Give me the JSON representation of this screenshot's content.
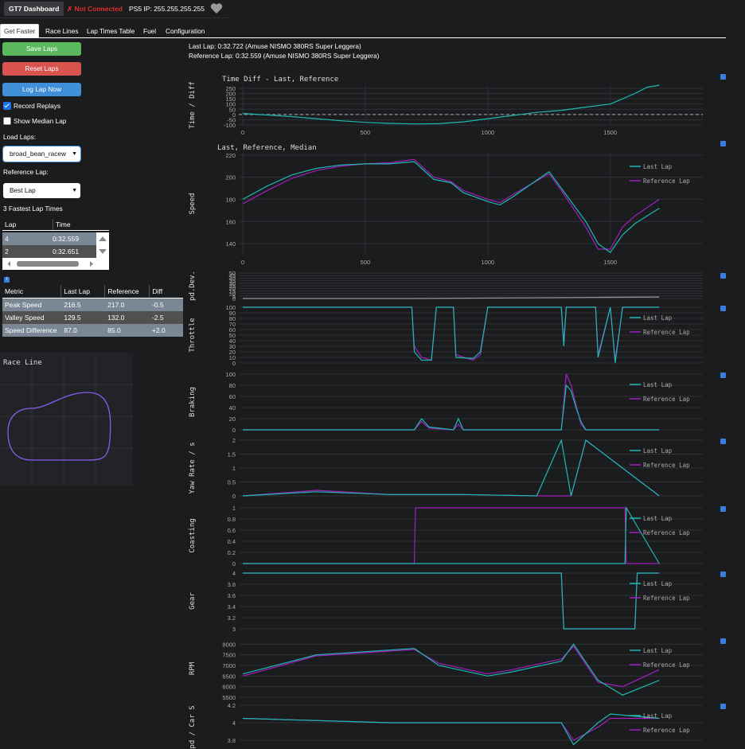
{
  "header": {
    "brand": "GT7 Dashboard",
    "connection_status": "✗ Not Connected",
    "ps5_ip": "PS5 IP: 255.255.255.255",
    "heart_icon": "heart-icon"
  },
  "tabs": [
    "Get Faster",
    "Race Lines",
    "Lap Times Table",
    "Fuel",
    "Configuration"
  ],
  "sidebar": {
    "save_laps": "Save Laps",
    "reset_laps": "Reset Laps",
    "log_lap_now": "Log Lap Now",
    "record_replays": "Record Replays",
    "show_median_lap": "Show Median Lap",
    "load_laps_label": "Load Laps:",
    "load_laps_value": "broad_bean_racew",
    "reference_lap_label": "Reference Lap:",
    "reference_lap_value": "Best Lap",
    "fastest_title": "3 Fastest Lap Times",
    "fastest_headers": [
      "Lap",
      "Time"
    ],
    "fastest_rows": [
      [
        "4",
        "0:32.559"
      ],
      [
        "2",
        "0:32.651"
      ]
    ],
    "metric_headers": [
      "Metric",
      "Last Lap",
      "Reference",
      "Diff"
    ],
    "metric_rows": [
      [
        "Peak Speed",
        "216.5",
        "217.0",
        "-0.5"
      ],
      [
        "Valley Speed",
        "129.5",
        "132.0",
        "-2.5"
      ],
      [
        "Speed Difference",
        "87.0",
        "85.0",
        "+2.0"
      ]
    ],
    "race_line_title": "Race Line"
  },
  "lap_info": {
    "last_lap": "Last Lap: 0:32.722 (Amuse NISMO 380RS Super Leggera)",
    "reference_lap": "Reference Lap: 0:32.559 (Amuse NISMO 380RS Super Leggera)"
  },
  "colors": {
    "last": "#1fb8b0",
    "reference": "#a020c0",
    "median": "#9a9a9a",
    "grid": "#2e3036"
  },
  "chart_data": [
    {
      "type": "line",
      "title": "Time Diff - Last, Reference",
      "ylabel": "Time / Diff",
      "x": [
        0,
        100,
        200,
        300,
        400,
        500,
        600,
        700,
        800,
        900,
        1000,
        1100,
        1200,
        1300,
        1400,
        1500,
        1600,
        1650,
        1700
      ],
      "series": [
        {
          "values": [
            10,
            -5,
            -20,
            -40,
            -60,
            -75,
            -85,
            -90,
            -88,
            -70,
            -40,
            -10,
            20,
            40,
            70,
            100,
            200,
            260,
            280
          ]
        }
      ],
      "ylim": [
        -100,
        280
      ],
      "yticks": [
        -100,
        -50,
        0,
        50,
        100,
        150,
        200,
        250
      ],
      "xticks": [
        0,
        500,
        1000,
        1500
      ],
      "dashed_y": 0
    },
    {
      "type": "line",
      "title": "Last, Reference, Median",
      "ylabel": "Speed",
      "x": [
        0,
        100,
        200,
        300,
        400,
        500,
        600,
        700,
        730,
        780,
        850,
        900,
        1000,
        1050,
        1100,
        1250,
        1300,
        1400,
        1450,
        1500,
        1550,
        1600,
        1700
      ],
      "series": [
        {
          "name": "Last Lap",
          "values": [
            180,
            192,
            202,
            208,
            211,
            212,
            212,
            214,
            208,
            198,
            195,
            186,
            178,
            175,
            182,
            205,
            190,
            160,
            140,
            132,
            148,
            158,
            172
          ]
        },
        {
          "name": "Reference Lap",
          "values": [
            176,
            188,
            199,
            206,
            210,
            212,
            213,
            216,
            210,
            200,
            196,
            188,
            180,
            177,
            184,
            203,
            188,
            155,
            135,
            135,
            155,
            165,
            180
          ]
        }
      ],
      "ylim": [
        130,
        222
      ],
      "yticks": [
        140,
        160,
        180,
        200,
        220
      ],
      "xticks": [
        0,
        500,
        1000,
        1500
      ]
    },
    {
      "type": "line",
      "ylabel": "pd.Dev.",
      "x": [
        0,
        700,
        1400,
        1700
      ],
      "series": [
        {
          "values": [
            0,
            0,
            2,
            3
          ]
        }
      ],
      "ylim": [
        0,
        50
      ],
      "yticks": [
        0,
        5,
        10,
        15,
        20,
        25,
        30,
        35,
        40,
        45,
        50
      ]
    },
    {
      "type": "line",
      "ylabel": "Throttle",
      "x": [
        0,
        690,
        700,
        730,
        770,
        790,
        860,
        870,
        940,
        970,
        1000,
        1020,
        1300,
        1310,
        1320,
        1360,
        1440,
        1450,
        1500,
        1520,
        1550,
        1700
      ],
      "series": [
        {
          "name": "Last Lap",
          "values": [
            100,
            100,
            20,
            5,
            5,
            100,
            100,
            10,
            8,
            20,
            100,
            100,
            100,
            30,
            100,
            100,
            100,
            10,
            100,
            0,
            100,
            100
          ]
        },
        {
          "name": "Reference Lap",
          "values": [
            100,
            100,
            30,
            10,
            5,
            100,
            100,
            15,
            5,
            15,
            100,
            100,
            100,
            40,
            100,
            100,
            100,
            15,
            100,
            5,
            100,
            100
          ]
        }
      ],
      "ylim": [
        0,
        100
      ],
      "yticks": [
        0,
        10,
        20,
        30,
        40,
        50,
        60,
        70,
        80,
        90,
        100
      ]
    },
    {
      "type": "line",
      "ylabel": "Braking",
      "x": [
        0,
        700,
        730,
        760,
        860,
        880,
        900,
        1300,
        1320,
        1340,
        1360,
        1380,
        1400,
        1700
      ],
      "series": [
        {
          "name": "Last Lap",
          "values": [
            0,
            0,
            20,
            5,
            0,
            20,
            0,
            0,
            80,
            70,
            40,
            15,
            0,
            0
          ]
        },
        {
          "name": "Reference Lap",
          "values": [
            0,
            0,
            15,
            3,
            0,
            10,
            0,
            0,
            100,
            80,
            45,
            10,
            0,
            0
          ]
        }
      ],
      "ylim": [
        0,
        100
      ],
      "yticks": [
        0,
        20,
        40,
        60,
        80,
        100
      ]
    },
    {
      "type": "line",
      "ylabel": "Yaw Rate / s",
      "x": [
        0,
        300,
        600,
        900,
        1200,
        1300,
        1340,
        1400,
        1700
      ],
      "series": [
        {
          "name": "Last Lap",
          "values": [
            0,
            0.15,
            0.05,
            0.05,
            0,
            2,
            0,
            2,
            0
          ]
        },
        {
          "name": "Reference Lap",
          "values": [
            0,
            0.2,
            0.05,
            0.05,
            0,
            0,
            0,
            2,
            0
          ]
        }
      ],
      "ylim": [
        0,
        2
      ],
      "yticks": [
        0,
        0.5,
        1,
        1.5,
        2
      ]
    },
    {
      "type": "line",
      "ylabel": "Coasting",
      "x": [
        0,
        700,
        705,
        1560,
        1565,
        1700
      ],
      "series": [
        {
          "name": "Last Lap",
          "values": [
            0,
            0,
            0,
            0,
            1,
            0
          ]
        },
        {
          "name": "Reference Lap",
          "values": [
            0,
            0,
            1,
            1,
            0,
            0
          ]
        }
      ],
      "ylim": [
        0,
        1
      ],
      "yticks": [
        0,
        0.2,
        0.4,
        0.6,
        0.8,
        1
      ]
    },
    {
      "type": "line",
      "ylabel": "Gear",
      "x": [
        0,
        1300,
        1310,
        1600,
        1610,
        1700
      ],
      "series": [
        {
          "name": "Last Lap",
          "values": [
            4,
            4,
            3,
            3,
            4,
            4
          ]
        },
        {
          "name": "Reference Lap",
          "values": [
            4,
            4,
            3,
            3,
            4,
            4
          ]
        }
      ],
      "ylim": [
        3,
        4
      ],
      "yticks": [
        3,
        3.2,
        3.4,
        3.6,
        3.8,
        4
      ]
    },
    {
      "type": "line",
      "ylabel": "RPM",
      "x": [
        0,
        300,
        700,
        800,
        1000,
        1100,
        1300,
        1350,
        1450,
        1550,
        1700
      ],
      "series": [
        {
          "name": "Last Lap",
          "values": [
            6600,
            7500,
            7800,
            7000,
            6500,
            6700,
            7200,
            8000,
            6300,
            5600,
            6300
          ]
        },
        {
          "name": "Reference Lap",
          "values": [
            6500,
            7450,
            7750,
            7100,
            6600,
            6800,
            7300,
            7900,
            6200,
            6000,
            6800
          ]
        }
      ],
      "ylim": [
        5500,
        8200
      ],
      "yticks": [
        5500,
        6000,
        6500,
        7000,
        7500,
        8000
      ]
    },
    {
      "type": "line",
      "ylabel": "pd / Car S",
      "x": [
        0,
        600,
        1300,
        1350,
        1450,
        1500,
        1700
      ],
      "series": [
        {
          "name": "Last Lap",
          "values": [
            4.05,
            4.0,
            4.0,
            3.75,
            4.0,
            4.1,
            4.05
          ]
        },
        {
          "name": "Reference Lap",
          "values": [
            4.05,
            4.0,
            4.0,
            3.8,
            3.95,
            4.05,
            4.05
          ]
        }
      ],
      "ylim": [
        3.7,
        4.2
      ],
      "yticks": [
        3.8,
        4,
        4.2
      ]
    }
  ],
  "legend": {
    "last": "Last Lap",
    "reference": "Reference Lap"
  }
}
